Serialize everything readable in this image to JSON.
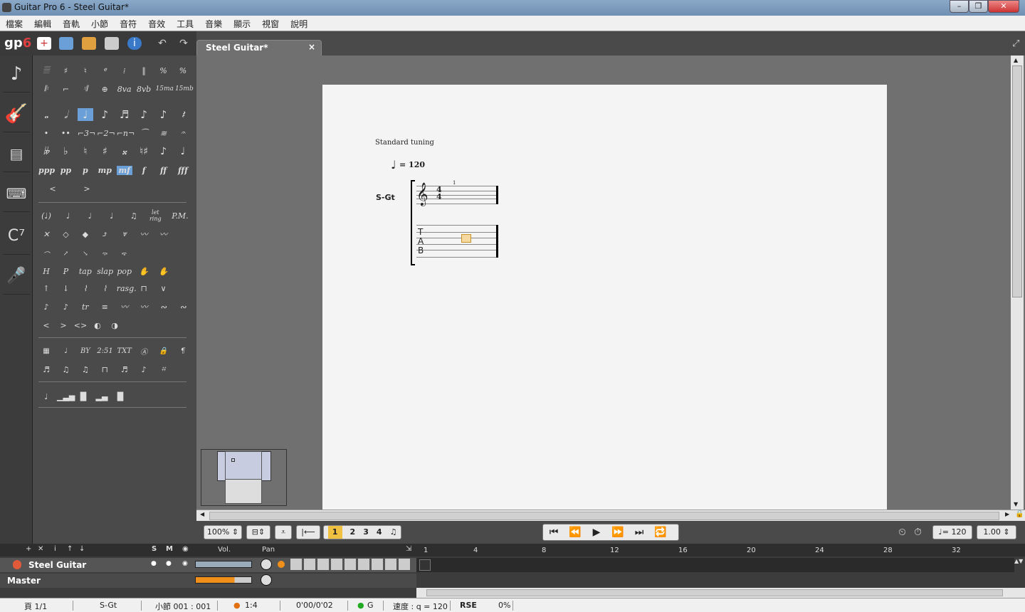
{
  "window": {
    "title": "Guitar Pro 6 - Steel Guitar*"
  },
  "menu": [
    "檔案",
    "編輯",
    "音軌",
    "小節",
    "音符",
    "音效",
    "工具",
    "音樂",
    "顯示",
    "視窗",
    "說明"
  ],
  "toolbar": {
    "logo_main": "gp",
    "logo_num": "6"
  },
  "tab": {
    "label": "Steel Guitar*",
    "close": "×"
  },
  "score": {
    "tuning": "Standard tuning",
    "tempo": "= 120",
    "track_short": "S-Gt",
    "time_sig_top": "4",
    "time_sig_bottom": "4",
    "bar_number": "1",
    "tab_letters": [
      "T",
      "A",
      "B"
    ]
  },
  "palette": {
    "row1": [
      "𝄚",
      "⁞",
      "‖",
      "%",
      "%",
      "",
      "",
      ""
    ],
    "row2": [
      "8va",
      "8vb",
      "15ma",
      "15mb"
    ],
    "dynamics": [
      "ppp",
      "pp",
      "p",
      "mp",
      "mf",
      "f",
      "ff",
      "fff"
    ],
    "techniques": [
      "tap",
      "slap",
      "pop"
    ],
    "pm": "P.M.",
    "letring": "let ring",
    "rasg": "rasg.",
    "text": [
      "BY",
      "2:51",
      "TXT"
    ]
  },
  "navbar": {
    "zoom": "100%",
    "voices": [
      "1",
      "2",
      "3",
      "4"
    ],
    "tempo": "= 120",
    "speed": "1.00"
  },
  "tracks": {
    "header": {
      "vol": "Vol.",
      "pan": "Pan",
      "s": "S",
      "m": "M"
    },
    "track1": "Steel Guitar",
    "master": "Master",
    "timeline": [
      "1",
      "4",
      "8",
      "12",
      "16",
      "20",
      "24",
      "28",
      "32"
    ]
  },
  "status": {
    "page": "頁 1/1",
    "track": "S-Gt",
    "bar": "小節 001 : 001",
    "sig": "1:4",
    "time": "0'00/0'02",
    "key": "G",
    "tempo": "速度 : q = 120",
    "rse": "RSE",
    "pct": "0%"
  }
}
